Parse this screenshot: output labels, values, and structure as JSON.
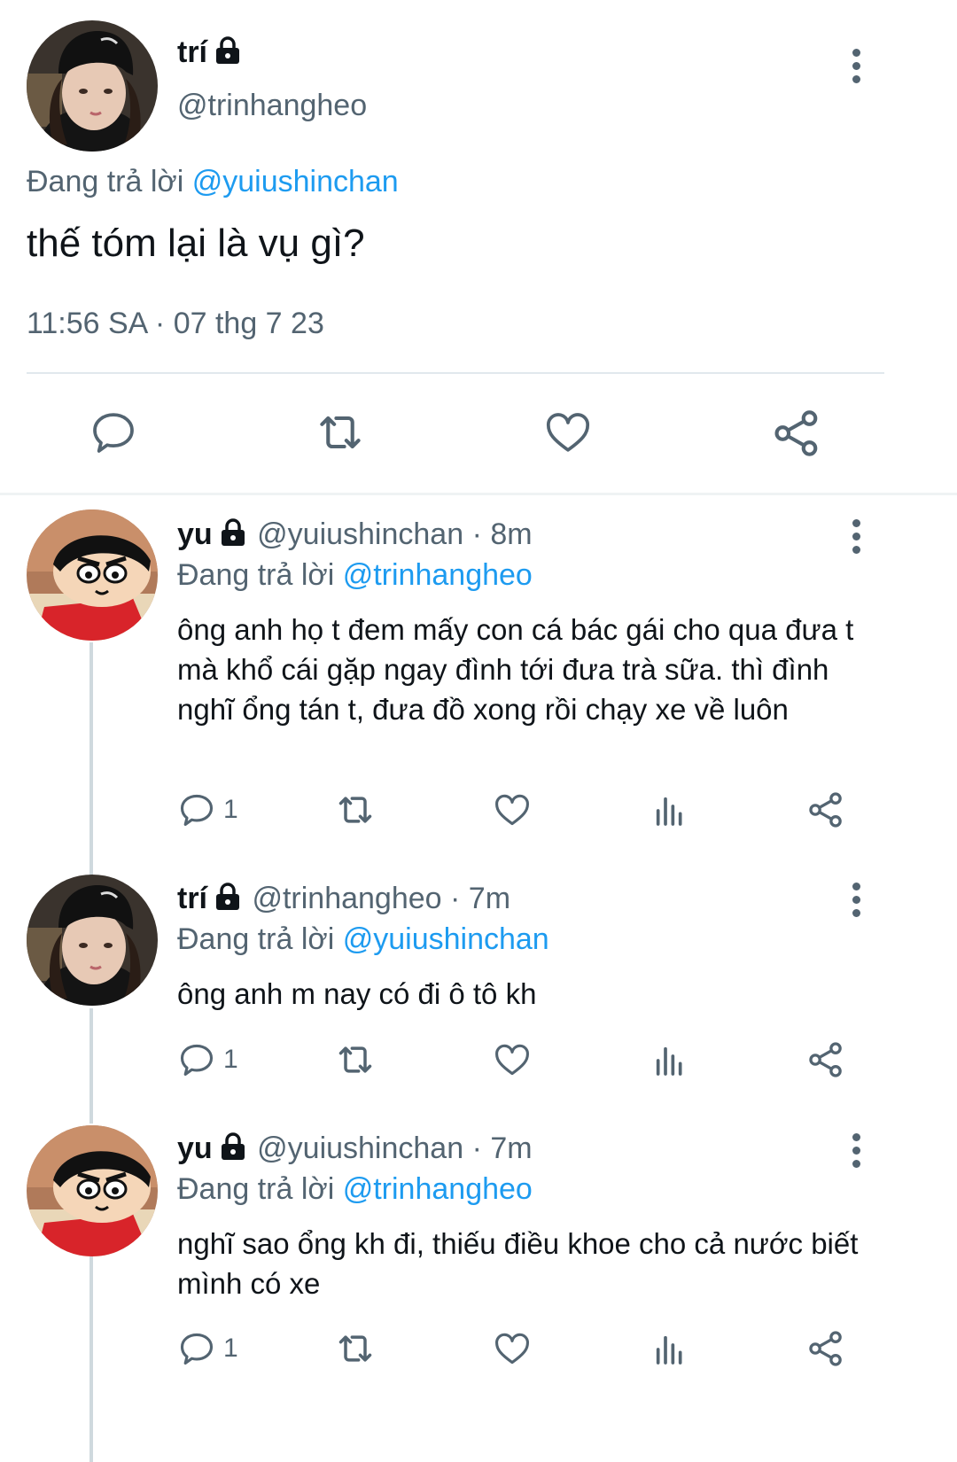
{
  "main_tweet": {
    "name": "trí",
    "handle": "@trinhangheo",
    "reply_prefix": "Đang trả lời",
    "reply_to": "@yuiushinchan",
    "text": "thế tóm lại là vụ gì?",
    "timestamp": "11:56 SA · 07 thg 7 23"
  },
  "replies": [
    {
      "name": "yu",
      "handle_time": "@yuiushinchan · 8m",
      "reply_prefix": "Đang trả lời",
      "reply_to": "@trinhangheo",
      "text": "ông anh họ t đem mấy con cá bác gái cho qua đưa t mà khổ cái gặp ngay đình tới đưa trà sữa. thì đình nghĩ ổng tán t, đưa đồ xong rồi chạy xe về luôn",
      "reply_count": "1"
    },
    {
      "name": "trí",
      "handle_time": "@trinhangheo · 7m",
      "reply_prefix": "Đang trả lời",
      "reply_to": "@yuiushinchan",
      "text": "ông anh m nay có đi ô tô kh",
      "reply_count": "1"
    },
    {
      "name": "yu",
      "handle_time": "@yuiushinchan · 7m",
      "reply_prefix": "Đang trả lời",
      "reply_to": "@trinhangheo",
      "text": "nghĩ sao ổng kh đi, thiếu điều khoe cho cả nước biết mình có xe",
      "reply_count": "1"
    }
  ],
  "icons": {
    "reply": "reply-icon",
    "retweet": "retweet-icon",
    "like": "heart-icon",
    "views": "views-icon",
    "share": "share-icon",
    "more": "more-vertical-icon",
    "lock": "lock-icon"
  },
  "colors": {
    "accent": "#1d9bf0",
    "secondary_text": "#536471",
    "divider": "#cfd9de"
  }
}
